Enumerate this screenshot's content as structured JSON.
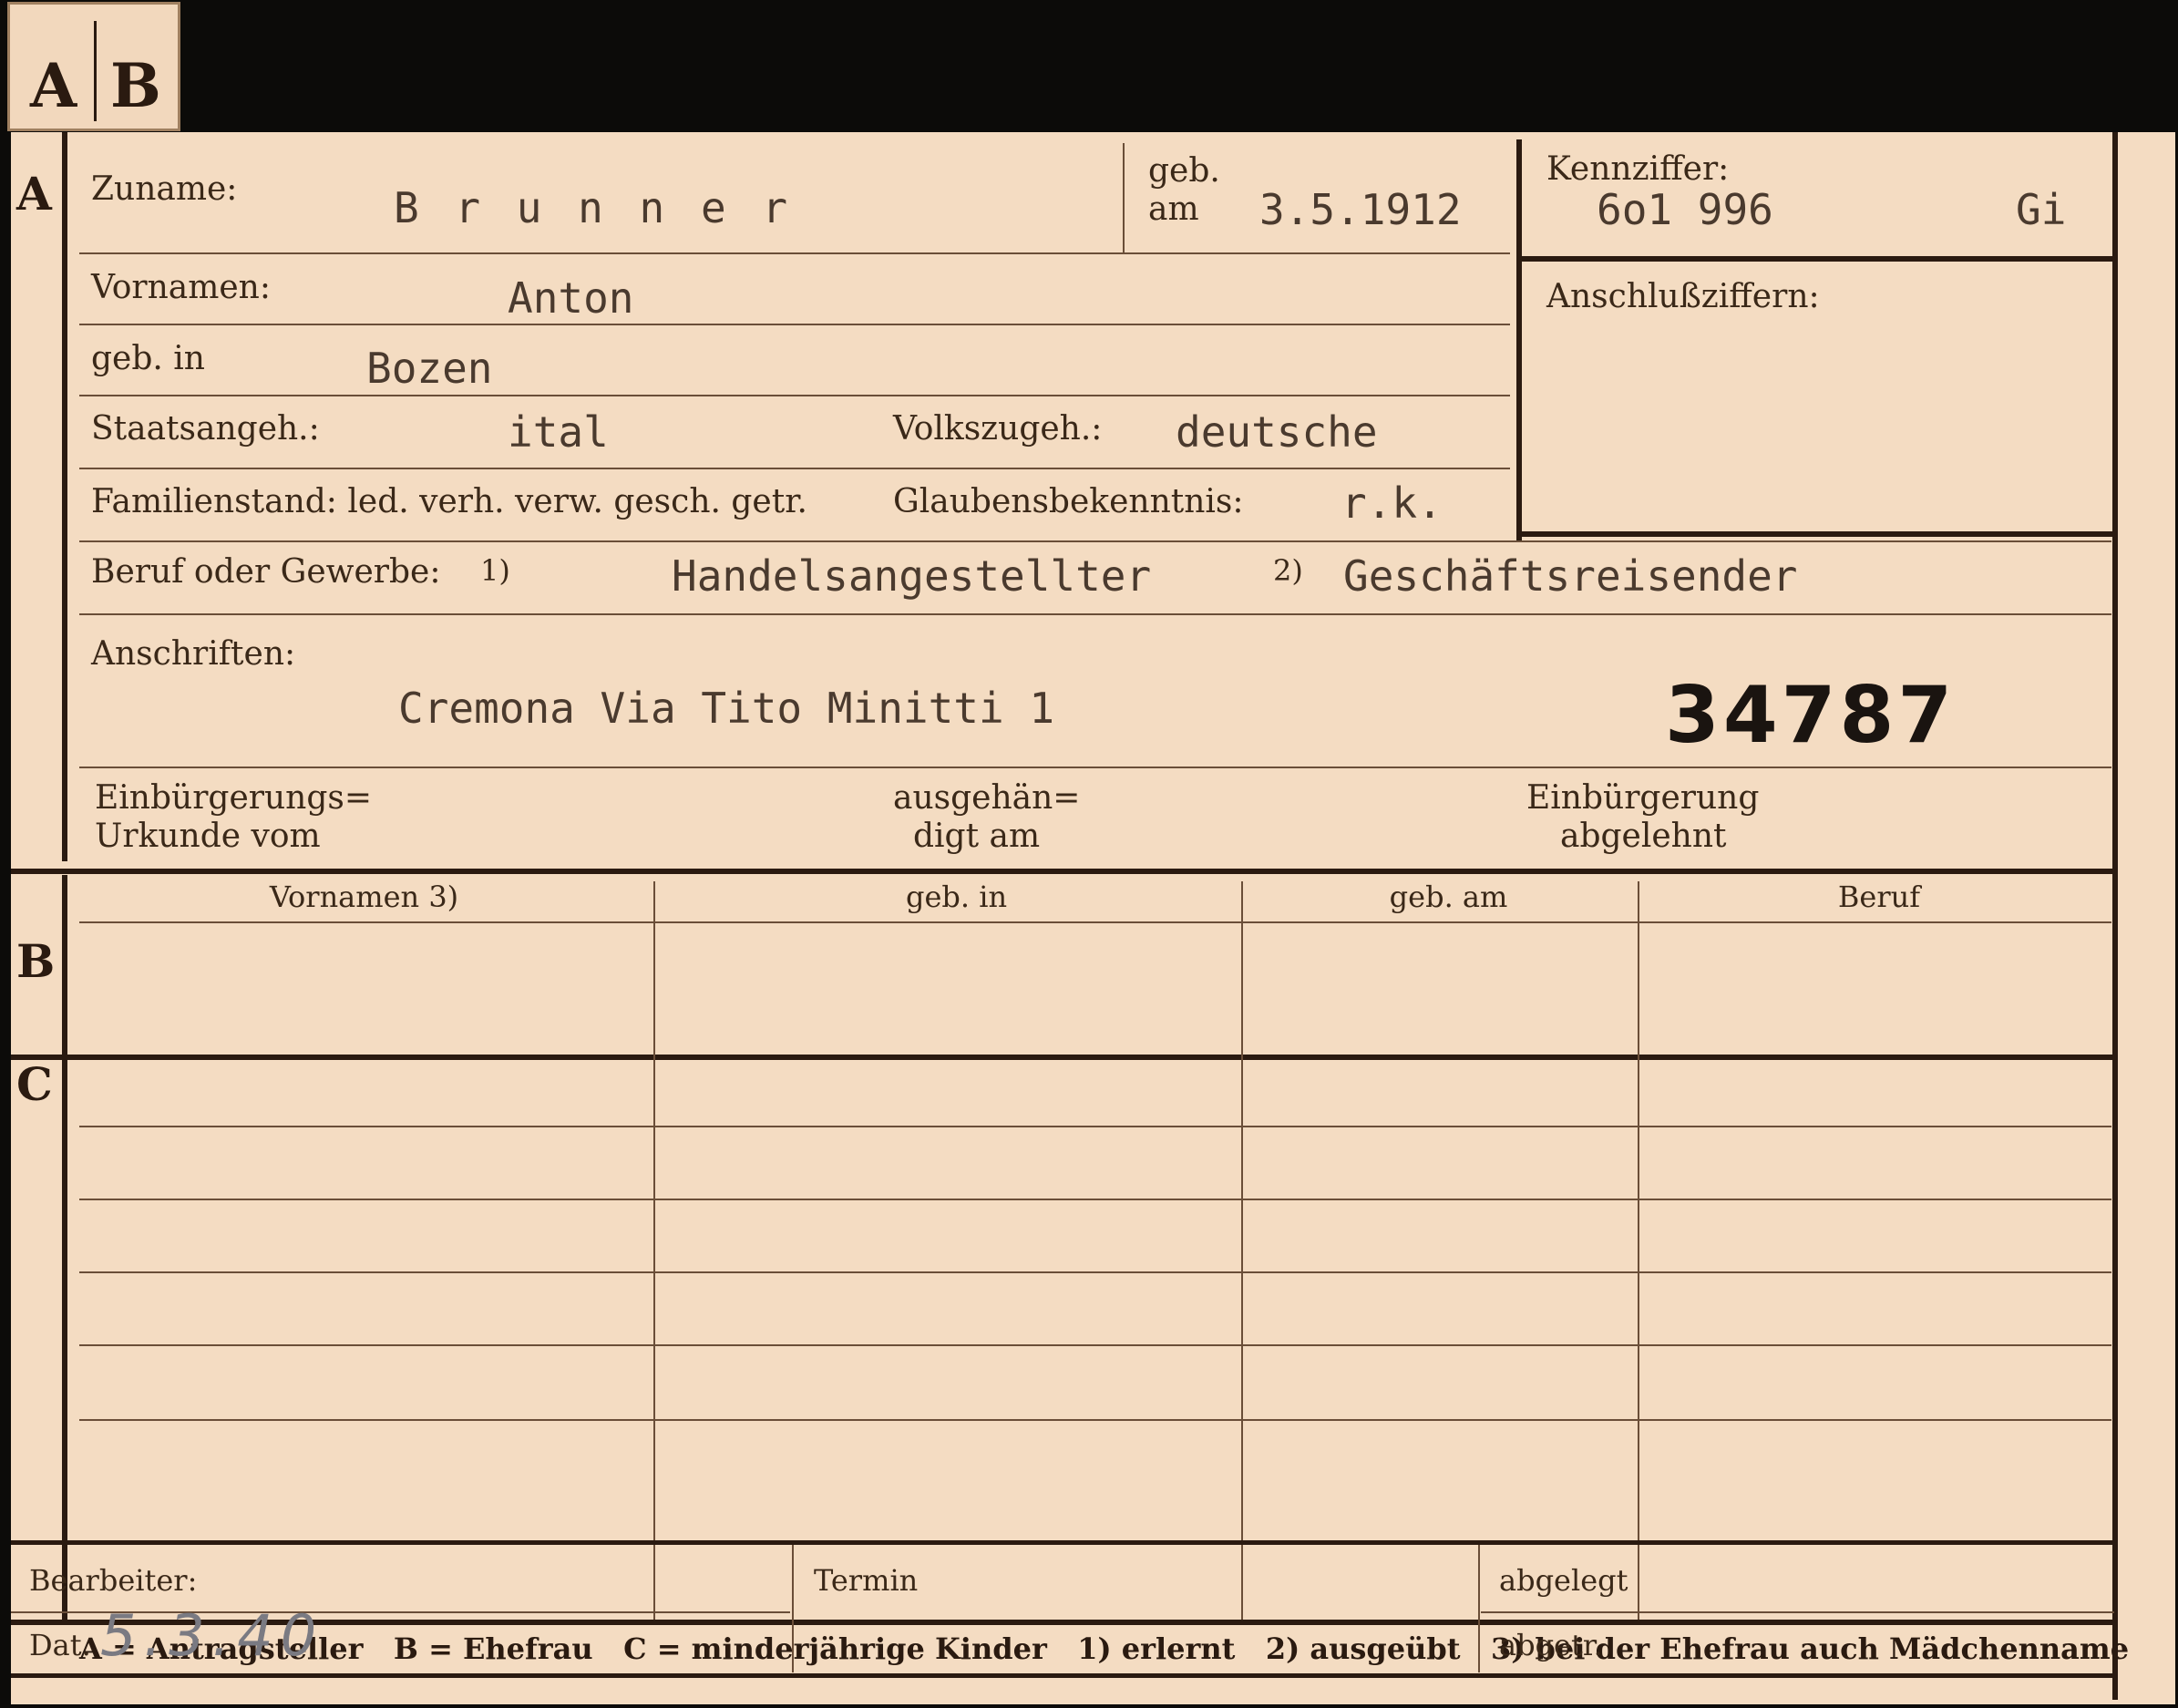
{
  "tab": {
    "a": "A",
    "b": "B"
  },
  "sections": {
    "a": "A",
    "b": "B",
    "c": "C"
  },
  "a": {
    "zuname_label": "Zuname:",
    "zuname_value": "B r u n n e r",
    "geb_label": "geb.",
    "am_label": "am",
    "geb_am_value": "3.5.1912",
    "kennziffer_label": "Kennziffer:",
    "kennziffer_value": "6o1 996",
    "kennziffer_suffix": "Gi",
    "anschluss_label": "Anschlußziffern:",
    "vornamen_label": "Vornamen:",
    "vornamen_value": "Anton",
    "gebin_label": "geb. in",
    "gebin_value": "Bozen",
    "staat_label": "Staatsangeh.:",
    "staat_value": "ital",
    "volk_label": "Volkszugeh.:",
    "volk_value": "deutsche",
    "familien_label": "Familienstand: led. verh. verw. gesch. getr.",
    "glauben_label": "Glaubensbekenntnis:",
    "glauben_value": "r.k.",
    "beruf_label": "Beruf oder Gewerbe:",
    "beruf_mark1": "1)",
    "beruf_value1": "Handelsangestellter",
    "beruf_mark2": "2)",
    "beruf_value2": "Geschäftsreisender",
    "anschriften_label": "Anschriften:",
    "anschriften_value": "Cremona Via Tito Minitti 1",
    "stamp_number": "34787",
    "einb_label_1": "Einbürgerungs=",
    "einb_label_2": "Urkunde vom",
    "ausg_label_1": "ausgehän=",
    "ausg_label_2": "digt am",
    "abgel_label_1": "Einbürgerung",
    "abgel_label_2": "abgelehnt"
  },
  "b": {
    "columns": [
      "Vornamen 3)",
      "geb. in",
      "geb. am",
      "Beruf"
    ]
  },
  "legend": "A = Antragsteller   B = Ehefrau   C = minderjährige Kinder   1) erlernt   2) ausgeübt   3) bei der Ehefrau auch Mädchenname",
  "footer": {
    "bearbeiter_label": "Bearbeiter:",
    "dat_label": "Dat.",
    "dat_value": "5.3.40",
    "termin_label": "Termin",
    "abgelegt_label": "abgelegt",
    "abgetr_label": "abgetr."
  },
  "colors": {
    "paper": "#f4dcc2",
    "ink": "#2a1a10",
    "background": "#0c0b09"
  }
}
